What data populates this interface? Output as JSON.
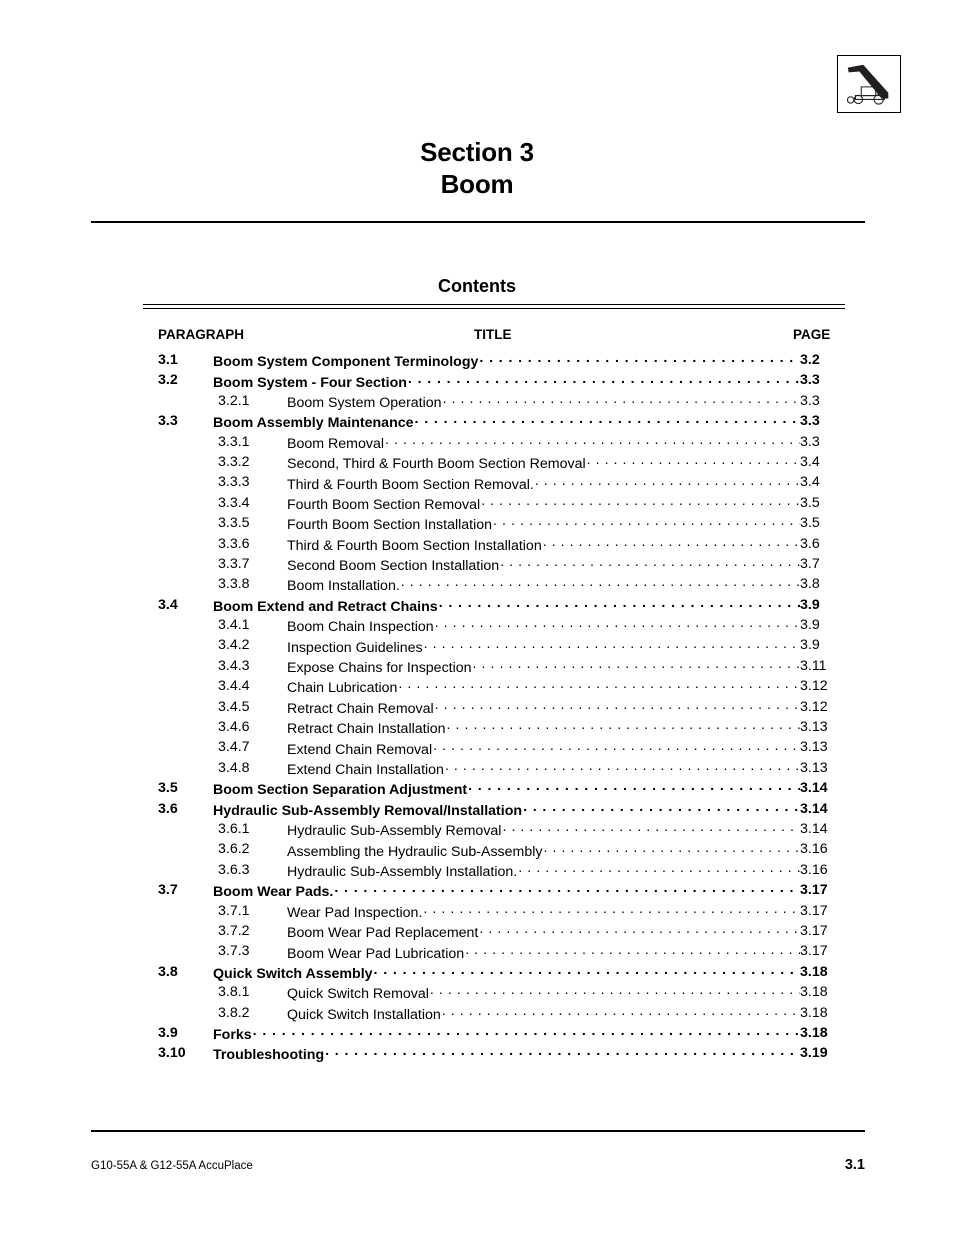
{
  "header": {
    "icon_name": "telehandler-boom-icon"
  },
  "title": {
    "line1": "Section 3",
    "line2": "Boom"
  },
  "contents": {
    "heading": "Contents",
    "columns": {
      "paragraph": "PARAGRAPH",
      "title": "TITLE",
      "page": "PAGE"
    },
    "entries": [
      {
        "level": 1,
        "number": "3.1",
        "title": "Boom System Component Terminology",
        "page": "3.2"
      },
      {
        "level": 1,
        "number": "3.2",
        "title": "Boom System - Four Section",
        "page": "3.3"
      },
      {
        "level": 2,
        "number": "3.2.1",
        "title": "Boom System Operation",
        "page": "3.3"
      },
      {
        "level": 1,
        "number": "3.3",
        "title": "Boom Assembly Maintenance",
        "page": "3.3"
      },
      {
        "level": 2,
        "number": "3.3.1",
        "title": "Boom Removal",
        "page": "3.3"
      },
      {
        "level": 2,
        "number": "3.3.2",
        "title": "Second, Third & Fourth Boom Section Removal",
        "page": "3.4"
      },
      {
        "level": 2,
        "number": "3.3.3",
        "title": "Third & Fourth Boom Section Removal.",
        "page": "3.4"
      },
      {
        "level": 2,
        "number": "3.3.4",
        "title": "Fourth Boom Section Removal",
        "page": "3.5"
      },
      {
        "level": 2,
        "number": "3.3.5",
        "title": "Fourth Boom Section Installation",
        "page": "3.5"
      },
      {
        "level": 2,
        "number": "3.3.6",
        "title": "Third & Fourth Boom Section Installation",
        "page": "3.6"
      },
      {
        "level": 2,
        "number": "3.3.7",
        "title": "Second Boom Section Installation",
        "page": "3.7"
      },
      {
        "level": 2,
        "number": "3.3.8",
        "title": "Boom Installation.",
        "page": "3.8"
      },
      {
        "level": 1,
        "number": "3.4",
        "title": "Boom Extend and Retract Chains",
        "page": "3.9"
      },
      {
        "level": 2,
        "number": "3.4.1",
        "title": "Boom Chain Inspection",
        "page": "3.9"
      },
      {
        "level": 2,
        "number": "3.4.2",
        "title": "Inspection Guidelines",
        "page": "3.9"
      },
      {
        "level": 2,
        "number": "3.4.3",
        "title": "Expose Chains for Inspection",
        "page": "3.11"
      },
      {
        "level": 2,
        "number": "3.4.4",
        "title": "Chain Lubrication",
        "page": "3.12"
      },
      {
        "level": 2,
        "number": "3.4.5",
        "title": "Retract Chain Removal",
        "page": "3.12"
      },
      {
        "level": 2,
        "number": "3.4.6",
        "title": "Retract Chain Installation",
        "page": "3.13"
      },
      {
        "level": 2,
        "number": "3.4.7",
        "title": "Extend Chain Removal",
        "page": "3.13"
      },
      {
        "level": 2,
        "number": "3.4.8",
        "title": "Extend Chain Installation",
        "page": "3.13"
      },
      {
        "level": 1,
        "number": "3.5",
        "title": "Boom Section Separation Adjustment",
        "page": "3.14"
      },
      {
        "level": 1,
        "number": "3.6",
        "title": "Hydraulic Sub-Assembly Removal/Installation",
        "page": "3.14"
      },
      {
        "level": 2,
        "number": "3.6.1",
        "title": "Hydraulic Sub-Assembly Removal",
        "page": "3.14"
      },
      {
        "level": 2,
        "number": "3.6.2",
        "title": "Assembling the Hydraulic Sub-Assembly",
        "page": "3.16"
      },
      {
        "level": 2,
        "number": "3.6.3",
        "title": "Hydraulic Sub-Assembly Installation.",
        "page": "3.16"
      },
      {
        "level": 1,
        "number": "3.7",
        "title": "Boom Wear Pads.",
        "page": "3.17"
      },
      {
        "level": 2,
        "number": "3.7.1",
        "title": "Wear Pad Inspection.",
        "page": "3.17"
      },
      {
        "level": 2,
        "number": "3.7.2",
        "title": "Boom Wear Pad Replacement",
        "page": "3.17"
      },
      {
        "level": 2,
        "number": "3.7.3",
        "title": "Boom Wear Pad Lubrication",
        "page": "3.17"
      },
      {
        "level": 1,
        "number": "3.8",
        "title": "Quick Switch Assembly",
        "page": "3.18"
      },
      {
        "level": 2,
        "number": "3.8.1",
        "title": "Quick Switch Removal",
        "page": "3.18"
      },
      {
        "level": 2,
        "number": "3.8.2",
        "title": "Quick Switch Installation",
        "page": "3.18"
      },
      {
        "level": 1,
        "number": "3.9",
        "title": "Forks",
        "page": "3.18"
      },
      {
        "level": 1,
        "number": "3.10",
        "title": "Troubleshooting",
        "page": "3.19"
      }
    ]
  },
  "footer": {
    "model": "G10-55A & G12-55A AccuPlace",
    "page_number": "3.1"
  }
}
